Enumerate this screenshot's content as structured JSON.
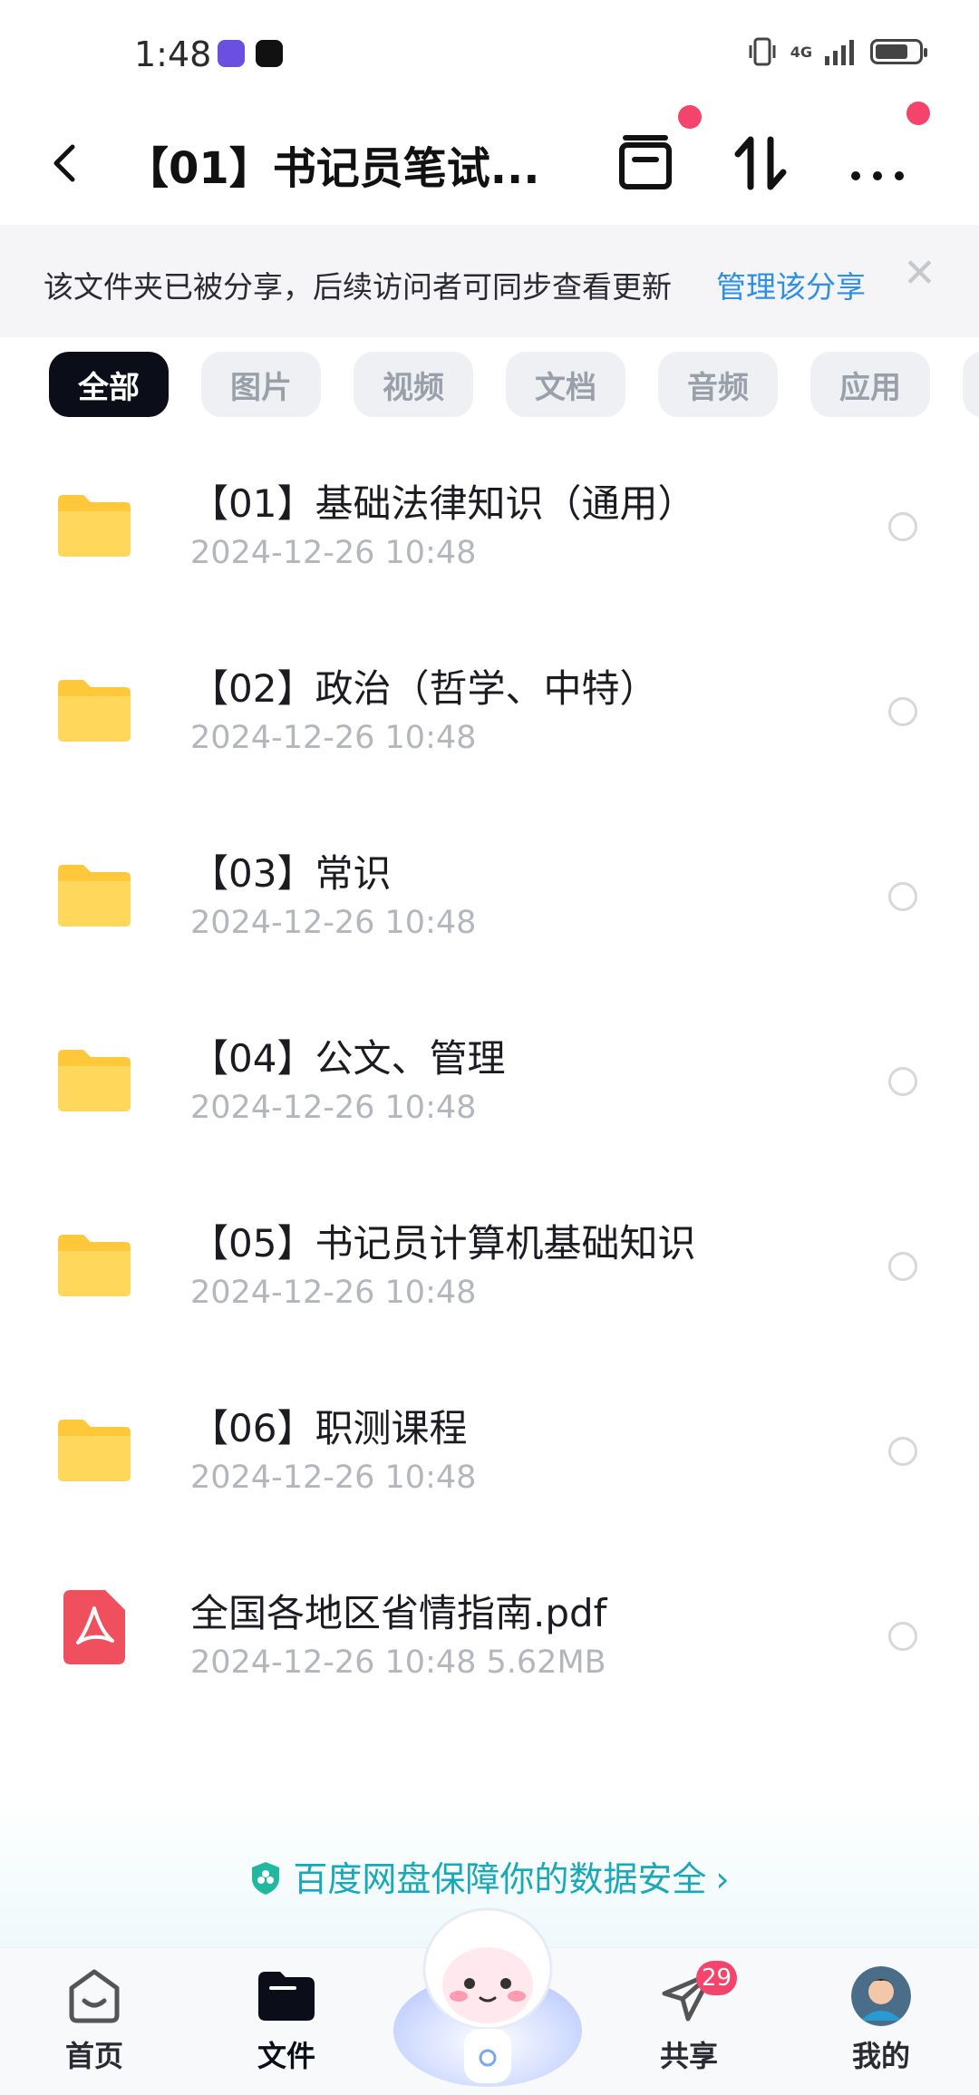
{
  "status_bar": {
    "time": "1:48",
    "network_label": "4G"
  },
  "header": {
    "title": "【01】书记员笔试..."
  },
  "share_banner": {
    "message": "该文件夹已被分享，后续访问者可同步查看更新",
    "manage_link": "管理该分享",
    "close_symbol": "✕"
  },
  "filter_tabs": [
    {
      "label": "全部",
      "active": true
    },
    {
      "label": "图片",
      "active": false
    },
    {
      "label": "视频",
      "active": false
    },
    {
      "label": "文档",
      "active": false
    },
    {
      "label": "音频",
      "active": false
    },
    {
      "label": "应用",
      "active": false
    }
  ],
  "files": [
    {
      "type": "folder",
      "name": "【01】基础法律知识（通用）",
      "meta": "2024-12-26  10:48"
    },
    {
      "type": "folder",
      "name": "【02】政治（哲学、中特）",
      "meta": "2024-12-26  10:48"
    },
    {
      "type": "folder",
      "name": "【03】常识",
      "meta": "2024-12-26  10:48"
    },
    {
      "type": "folder",
      "name": "【04】公文、管理",
      "meta": "2024-12-26  10:48"
    },
    {
      "type": "folder",
      "name": "【05】书记员计算机基础知识",
      "meta": "2024-12-26  10:48"
    },
    {
      "type": "folder",
      "name": "【06】职测课程",
      "meta": "2024-12-26  10:48"
    },
    {
      "type": "pdf",
      "name": "全国各地区省情指南.pdf",
      "meta": "2024-12-26  10:48  5.62MB"
    }
  ],
  "security_notice": {
    "text": "百度网盘保障你的数据安全",
    "arrow": "›"
  },
  "bottom_nav": {
    "home": "首页",
    "files": "文件",
    "share": "共享",
    "share_badge": "29",
    "me": "我的"
  },
  "colors": {
    "accent": "#2e8fe8",
    "badge": "#f5446b",
    "folder": "#ffd24a",
    "pdf": "#f0505e",
    "active_tab": "#0b0d19"
  },
  "battery_level": 0.75
}
